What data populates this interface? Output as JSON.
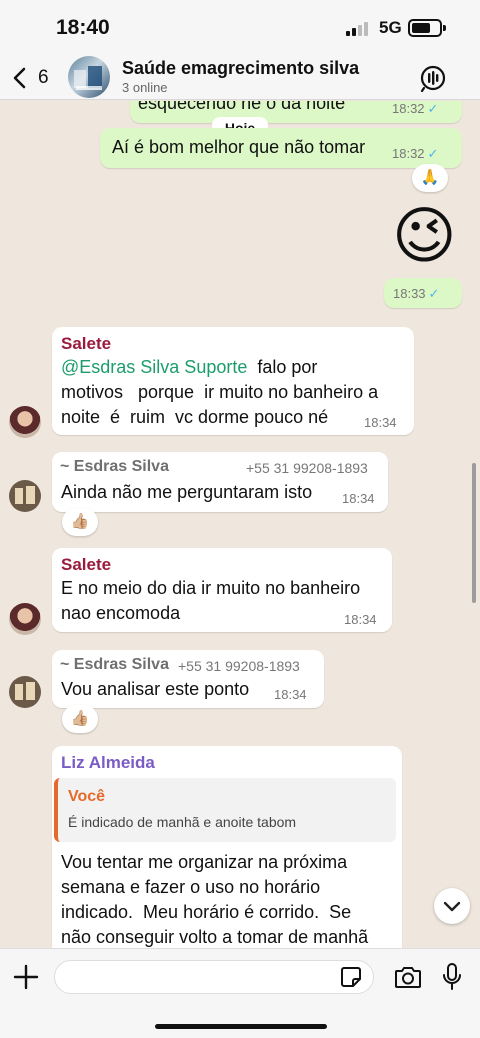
{
  "status_bar": {
    "time": "18:40",
    "network": "5G"
  },
  "header": {
    "back_count": "6",
    "group_name": "Saúde emagrecimento silva",
    "subtitle": "3 online"
  },
  "chat": {
    "date_label": "Hoje",
    "messages": [
      {
        "text": "esquecendo ne o da noite",
        "time": "18:32"
      },
      {
        "text": "Aí é bom melhor que não tomar",
        "time": "18:32",
        "reaction": "🙏"
      },
      {
        "emoji": "😉",
        "time": "18:33"
      },
      {
        "sender": "Salete",
        "mention": "@Esdras Silva Suporte",
        "text_line1": "  falo por",
        "text_line2": "motivos   porque  ir muito no banheiro a",
        "text_line3": "noite  é  ruim  vc dorme pouco né",
        "time": "18:34"
      },
      {
        "sender": "~ Esdras Silva",
        "phone": "+55 31 99208-1893",
        "text": "Ainda não me perguntaram isto",
        "time": "18:34",
        "reaction": "👍🏼"
      },
      {
        "sender": "Salete",
        "text_line1": "E no meio do dia ir muito no banheiro",
        "text_line2": "nao encomoda",
        "time": "18:34"
      },
      {
        "sender": "~ Esdras Silva",
        "phone": "+55 31 99208-1893",
        "text": "Vou analisar este ponto",
        "time": "18:34",
        "reaction": "👍🏼"
      },
      {
        "sender": "Liz Almeida",
        "quote_author": "Você",
        "quote_text": "É indicado de manhã e anoite tabom",
        "text_line1": "Vou tentar me organizar na próxima",
        "text_line2": "semana e fazer o uso no horário",
        "text_line3": "indicado.  Meu horário é corrido.  Se",
        "text_line4": "não conseguir volto a tomar de manhã"
      }
    ]
  },
  "colors": {
    "outgoing_bubble": "#dcf8c6",
    "incoming_bubble": "#ffffff",
    "salete_name": "#9b1b3f",
    "esdras_name": "#6f6f6f",
    "liz_name": "#7a5cc7",
    "quote_author": "#e56b2c",
    "mention": "#1c9d6b",
    "read_tick": "#4fb6ec"
  },
  "icons": {
    "back": "chevron-left-icon",
    "call": "group-call-icon",
    "plus": "plus-icon",
    "sticker": "sticker-icon",
    "camera": "camera-icon",
    "mic": "microphone-icon",
    "scroll_down": "chevron-down-icon"
  }
}
